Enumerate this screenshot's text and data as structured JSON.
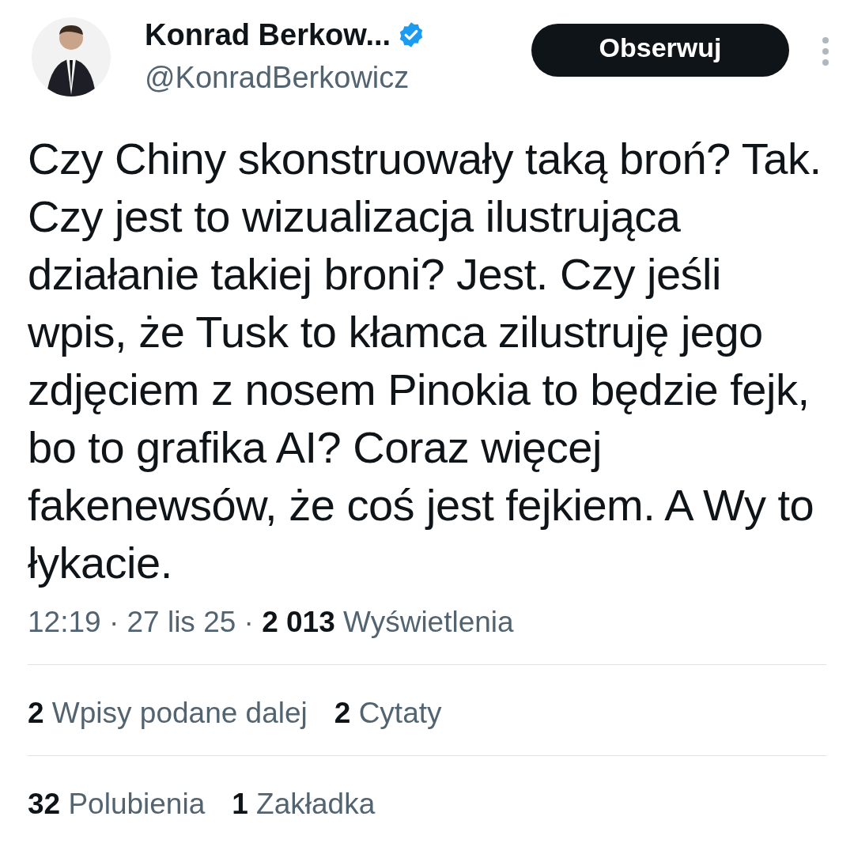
{
  "author": {
    "name": "Konrad Berkow...",
    "handle": "@KonradBerkowicz",
    "verified": true
  },
  "follow_button": {
    "label": "Obserwuj"
  },
  "text": "Czy Chiny skonstruowały taką broń? Tak. Czy jest to wizualizacja ilustrująca działanie takiej broni? Jest. Czy jeśli wpis, że Tusk to kłamca zilustruję jego zdjęciem z nosem Pinokia to będzie fejk, bo to grafika AI? Coraz więcej fakenewsów, że coś jest fejkiem. A Wy to łykacie.",
  "meta": {
    "time": "12:19",
    "separator": "·",
    "date": "27 lis 25",
    "views_count": "2 013",
    "views_label": "Wyświetlenia"
  },
  "stat_rows": [
    [
      {
        "count": "2",
        "label": "Wpisy podane dalej"
      },
      {
        "count": "2",
        "label": "Cytaty"
      }
    ],
    [
      {
        "count": "32",
        "label": "Polubienia"
      },
      {
        "count": "1",
        "label": "Zakładka"
      }
    ]
  ]
}
